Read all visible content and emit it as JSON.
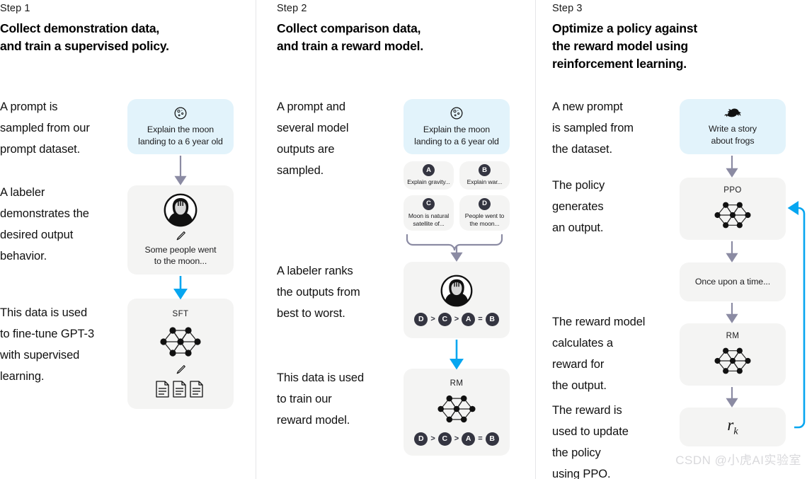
{
  "colors": {
    "accent_blue": "#06a6f0",
    "arrow_gray": "#8b8ba3",
    "card_gray": "#f4f4f3",
    "card_blue": "#e2f3fb",
    "badge_dark": "#343541",
    "divider": "#e6e6e8",
    "watermark": "#d9d9dc"
  },
  "watermark": "CSDN @小虎AI实验室",
  "steps": [
    {
      "label": "Step 1",
      "title": "Collect demonstration data,\nand train a supervised policy.",
      "paragraphs": [
        "A prompt is\nsampled from our\nprompt dataset.",
        "A labeler\ndemonstrates the\ndesired output\nbehavior.",
        "This data is used\nto fine-tune GPT-3\nwith supervised\nlearning."
      ],
      "cards": [
        {
          "name": "prompt-card",
          "icon": "moon-icon",
          "text": "Explain the moon\nlanding to a 6 year old"
        },
        {
          "name": "labeler-card",
          "icon": "labeler-avatar-icon",
          "text": "Some people went\nto the moon..."
        },
        {
          "name": "sft-model-card",
          "label": "SFT",
          "icon": "neural-network-icon"
        }
      ]
    },
    {
      "label": "Step 2",
      "title": "Collect comparison data,\nand train a reward model.",
      "paragraphs": [
        "A prompt and\nseveral model\noutputs are\nsampled.",
        "A labeler ranks\nthe outputs from\nbest to worst.",
        "This data is used\nto train our\nreward model."
      ],
      "cards": [
        {
          "name": "prompt-card",
          "icon": "moon-icon",
          "text": "Explain the moon\nlanding to a 6 year old"
        },
        {
          "name": "output-card-a",
          "badge": "A",
          "text": "Explain gravity..."
        },
        {
          "name": "output-card-b",
          "badge": "B",
          "text": "Explain war..."
        },
        {
          "name": "output-card-c",
          "badge": "C",
          "text": "Moon is natural\nsatellite of..."
        },
        {
          "name": "output-card-d",
          "badge": "D",
          "text": "People went to\nthe moon..."
        },
        {
          "name": "ranking-card",
          "icon": "labeler-avatar-icon",
          "ranking": [
            "D",
            ">",
            "C",
            ">",
            "A",
            "=",
            "B"
          ]
        },
        {
          "name": "rm-model-card",
          "label": "RM",
          "icon": "neural-network-icon",
          "ranking": [
            "D",
            ">",
            "C",
            ">",
            "A",
            "=",
            "B"
          ]
        }
      ]
    },
    {
      "label": "Step 3",
      "title": "Optimize a policy against\nthe reward model using\nreinforcement learning.",
      "paragraphs": [
        "A new prompt\nis sampled from\nthe dataset.",
        "The policy\ngenerates\nan output.",
        "The reward model\ncalculates a\nreward for\nthe output.",
        "The reward is\nused to update\nthe policy\nusing PPO."
      ],
      "cards": [
        {
          "name": "new-prompt-card",
          "icon": "frog-icon",
          "text": "Write a story\nabout frogs"
        },
        {
          "name": "ppo-model-card",
          "label": "PPO",
          "icon": "neural-network-icon"
        },
        {
          "name": "generated-output-card",
          "text": "Once upon a time..."
        },
        {
          "name": "rm-model-card",
          "label": "RM",
          "icon": "neural-network-icon"
        },
        {
          "name": "reward-card",
          "math": "r",
          "math_sub": "k"
        }
      ]
    }
  ]
}
